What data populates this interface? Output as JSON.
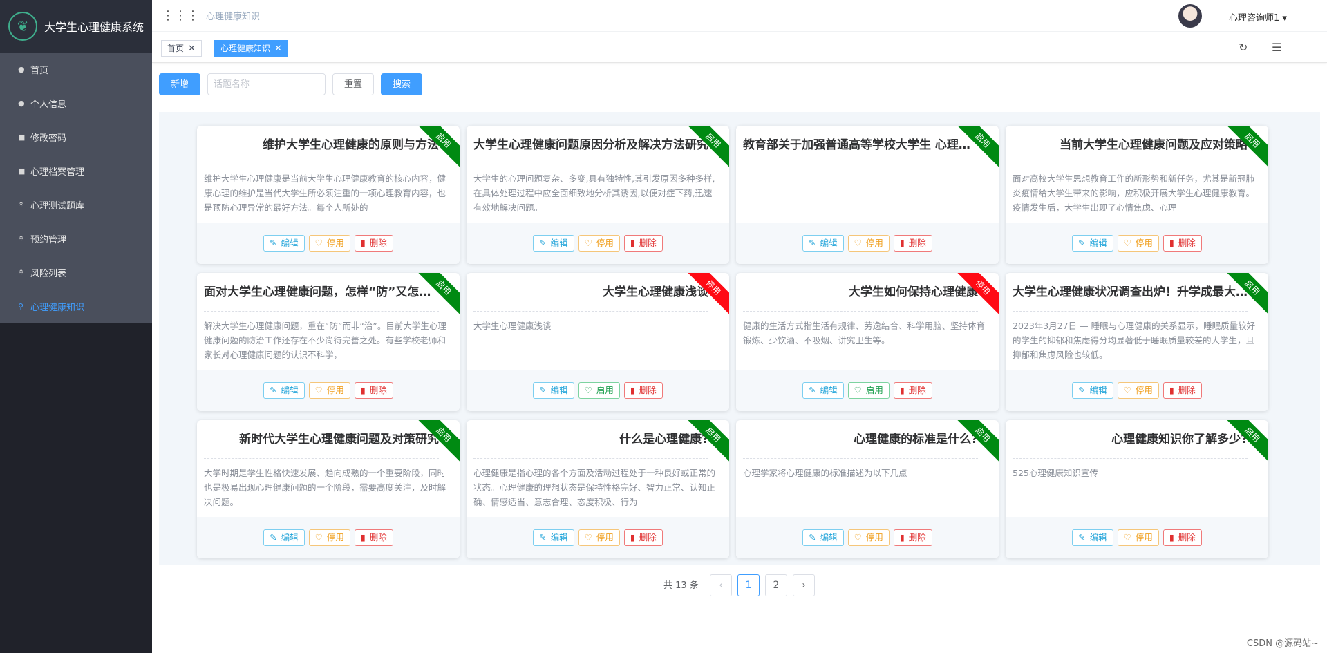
{
  "sidebar": {
    "logo_icon": "leaf-icon",
    "title": "大学生心理健康系统",
    "items": [
      {
        "label": "首页",
        "icon": "user-icon"
      },
      {
        "label": "个人信息",
        "icon": "user-icon"
      },
      {
        "label": "修改密码",
        "icon": "lock-icon"
      },
      {
        "label": "心理档案管理",
        "icon": "lock-icon"
      },
      {
        "label": "心理测试题库",
        "icon": "pin-icon"
      },
      {
        "label": "预约管理",
        "icon": "pin-icon"
      },
      {
        "label": "风险列表",
        "icon": "pin-icon"
      },
      {
        "label": "心理健康知识",
        "icon": "key-icon"
      }
    ]
  },
  "header": {
    "breadcrumb": "心理健康知识",
    "user_name": "心理咨询师1"
  },
  "tags": [
    {
      "label": "首页",
      "active": false
    },
    {
      "label": "心理健康知识",
      "active": true
    }
  ],
  "toolbar": {
    "add_label": "新增",
    "search_placeholder": "话题名称",
    "reset_label": "重置",
    "search_label": "搜索"
  },
  "action_labels": {
    "edit": "编辑",
    "stop": "停用",
    "start": "启用",
    "delete": "删除"
  },
  "cards": [
    {
      "title": "维护大学生心理健康的原则与方法",
      "status": "启用",
      "desc": "维护大学生心理健康是当前大学生心理健康教育的核心内容，健康心理的维护是当代大学生所必须注重的一项心理教育内容，也是预防心理异常的最好方法。每个人所处的"
    },
    {
      "title": "大学生心理健康问题原因分析及解决方法研究",
      "status": "启用",
      "desc": "大学生的心理问题复杂、多变,具有独特性,其引发原因多种多样,在具体处理过程中应全面细致地分析其诱因,以便对症下药,迅速有效地解决问题。"
    },
    {
      "title": "教育部关于加强普通高等学校大学生 心理健康教育工作的意见",
      "status": "启用",
      "desc": ""
    },
    {
      "title": "当前大学生心理健康问题及应对策略",
      "status": "启用",
      "desc": "面对高校大学生思想教育工作的新形势和新任务，尤其是新冠肺炎疫情给大学生带来的影响，应积极开展大学生心理健康教育。疫情发生后，大学生出现了心情焦虑、心理"
    },
    {
      "title": "面对大学生心理健康问题，怎样“防”又怎样“治”",
      "status": "启用",
      "desc": "解决大学生心理健康问题，重在“防”而非“治”。目前大学生心理健康问题的防治工作还存在不少尚待完善之处。有些学校老师和家长对心理健康问题的认识不科学，"
    },
    {
      "title": "大学生心理健康浅谈",
      "status": "停用",
      "desc": "大学生心理健康浅谈"
    },
    {
      "title": "大学生如何保持心理健康",
      "status": "停用",
      "desc": "健康的生活方式指生活有规律、劳逸结合、科学用脑、坚持体育锻炼、少饮酒、不吸烟、讲究卫生等。"
    },
    {
      "title": "大学生心理健康状况调查出炉！升学成最大压力源",
      "status": "启用",
      "desc": "2023年3月27日 — 睡眠与心理健康的关系显示，睡眠质量较好的学生的抑郁和焦虑得分均显著低于睡眠质量较差的大学生，且抑郁和焦虑风险也较低。"
    },
    {
      "title": "新时代大学生心理健康问题及对策研究",
      "status": "启用",
      "desc": "大学时期是学生性格快速发展、趋向成熟的一个重要阶段，同时也是极易出现心理健康问题的一个阶段，需要高度关注，及时解决问题。"
    },
    {
      "title": "什么是心理健康?",
      "status": "启用",
      "desc": "心理健康是指心理的各个方面及活动过程处于一种良好或正常的状态。心理健康的理想状态是保持性格完好、智力正常、认知正确、情感适当、意志合理、态度积极、行为"
    },
    {
      "title": "心理健康的标准是什么?",
      "status": "启用",
      "desc": "心理学家将心理健康的标准描述为以下几点"
    },
    {
      "title": "心理健康知识你了解多少?",
      "status": "启用",
      "desc": "525心理健康知识宣传"
    }
  ],
  "pagination": {
    "total": "共 13 条",
    "pages": [
      "1",
      "2"
    ],
    "current": "1"
  },
  "watermark": "CSDN @源码站~",
  "colors": {
    "primary": "#409eff",
    "ribbon_on": "#008a12",
    "ribbon_off": "#ff0a14",
    "sidebar_bg": "#20222a"
  }
}
